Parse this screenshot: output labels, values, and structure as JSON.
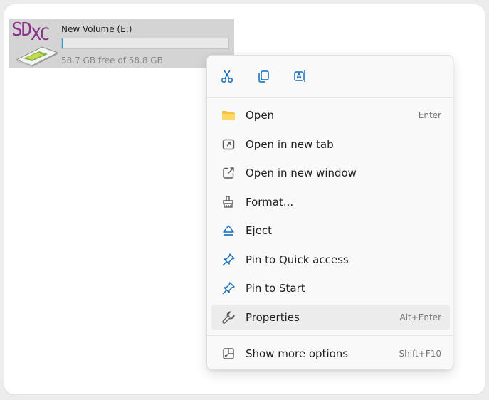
{
  "drive": {
    "logo_text": "SD",
    "logo_text_suffix": "XC",
    "name": "New Volume (E:)",
    "free_text": "58.7 GB free of 58.8 GB",
    "used_fraction": 0.002
  },
  "quick_actions": [
    {
      "icon": "cut-icon"
    },
    {
      "icon": "copy-icon"
    },
    {
      "icon": "rename-icon"
    }
  ],
  "menu_items": [
    {
      "label": "Open",
      "shortcut": "Enter",
      "icon": "folder-icon"
    },
    {
      "label": "Open in new tab",
      "shortcut": "",
      "icon": "new-tab-icon"
    },
    {
      "label": "Open in new window",
      "shortcut": "",
      "icon": "new-window-icon"
    },
    {
      "label": "Format...",
      "shortcut": "",
      "icon": "format-icon"
    },
    {
      "label": "Eject",
      "shortcut": "",
      "icon": "eject-icon"
    },
    {
      "label": "Pin to Quick access",
      "shortcut": "",
      "icon": "pin-icon"
    },
    {
      "label": "Pin to Start",
      "shortcut": "",
      "icon": "pin-icon"
    },
    {
      "label": "Properties",
      "shortcut": "Alt+Enter",
      "icon": "wrench-icon"
    },
    {
      "label": "Show more options",
      "shortcut": "Shift+F10",
      "icon": "more-options-icon"
    }
  ],
  "colors": {
    "accent": "#0f6cbd",
    "folder": "#f5c242",
    "logo": "#8a2f8a"
  }
}
